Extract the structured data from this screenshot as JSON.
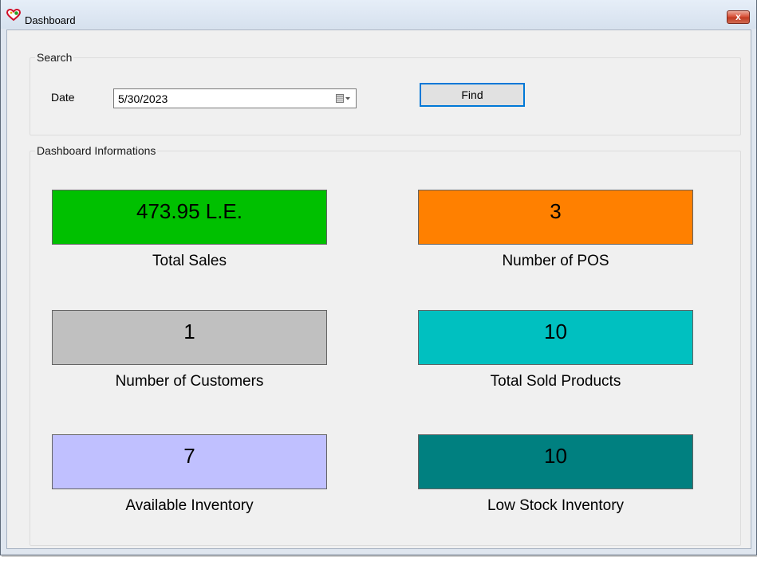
{
  "window": {
    "title": "Dashboard",
    "close_label": "x"
  },
  "search": {
    "title": "Search",
    "date_label": "Date",
    "date_value": "5/30/2023",
    "find_label": "Find"
  },
  "dashboard": {
    "title": "Dashboard Informations",
    "tiles": [
      {
        "value": "473.95 L.E.",
        "label": "Total Sales",
        "color": "#00c000"
      },
      {
        "value": "3",
        "label": "Number of POS",
        "color": "#ff8000"
      },
      {
        "value": "1",
        "label": "Number of Customers",
        "color": "#c0c0c0"
      },
      {
        "value": "10",
        "label": "Total Sold Products",
        "color": "#00c0c0"
      },
      {
        "value": "7",
        "label": "Available Inventory",
        "color": "#c0c0ff"
      },
      {
        "value": "10",
        "label": "Low Stock Inventory",
        "color": "#008080"
      }
    ]
  },
  "icons": {
    "app": "heart-app-icon",
    "calendar": "calendar-dropdown-icon",
    "close": "close-icon"
  }
}
